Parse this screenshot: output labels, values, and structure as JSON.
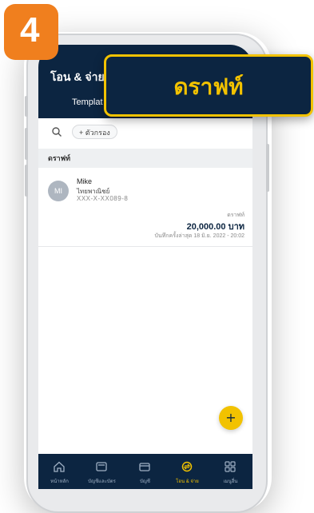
{
  "step_number": "4",
  "callout": {
    "text": "ดราฟท์"
  },
  "header": {
    "title": "โอน & จ่าย",
    "tab_label": "Templat"
  },
  "filter": {
    "add_label": "+ ตัวกรอง"
  },
  "section": {
    "title": "ดราฟท์"
  },
  "draft_item": {
    "avatar_initials": "MI",
    "name": "Mike",
    "bank": "ไทยพาณิชย์",
    "account": "XXX-X-XX089-8",
    "type": "ดราฟท์",
    "amount": "20,000.00 บาท",
    "date": "บันทึกครั้งล่าสุด 18 มิ.ย. 2022 - 20:02"
  },
  "fab": {
    "icon": "plus-icon",
    "label": "+"
  },
  "bottom_nav": {
    "items": [
      {
        "label": "หน้าหลัก",
        "icon": "home-icon"
      },
      {
        "label": "บัญชีและบัตร",
        "icon": "wallet-icon"
      },
      {
        "label": "บัญชี",
        "icon": "card-icon"
      },
      {
        "label": "โอน & จ่าย",
        "icon": "transfer-icon",
        "active": true
      },
      {
        "label": "เมนูอื่น",
        "icon": "grid-icon"
      }
    ]
  },
  "colors": {
    "navy": "#0c2541",
    "accent_yellow": "#f2c200",
    "step_orange": "#f07f1e"
  }
}
